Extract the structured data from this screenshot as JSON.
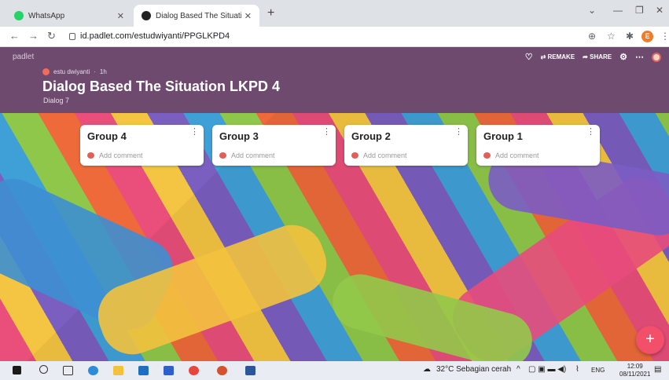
{
  "browser": {
    "tabs": [
      {
        "title": "WhatsApp",
        "active": false
      },
      {
        "title": "Dialog Based The Situation LKPD",
        "active": true
      }
    ],
    "url": "id.padlet.com/estudwiyanti/PPGLKPD4",
    "profile_initial": "E"
  },
  "padlet": {
    "logo": "padlet",
    "actions": {
      "remake": "REMAKE",
      "share": "SHARE"
    },
    "author": "estu dwiyanti",
    "time_ago": "1h",
    "title": "Dialog Based The Situation LKPD 4",
    "subtitle": "Dialog 7",
    "columns": [
      {
        "title": "Group 4",
        "comment_placeholder": "Add comment"
      },
      {
        "title": "Group 3",
        "comment_placeholder": "Add comment"
      },
      {
        "title": "Group 2",
        "comment_placeholder": "Add comment"
      },
      {
        "title": "Group 1",
        "comment_placeholder": "Add comment"
      }
    ],
    "fab_label": "+"
  },
  "taskbar": {
    "weather": "32°C  Sebagian cerah",
    "lang": "ENG",
    "time": "12:09",
    "date": "08/11/2021"
  },
  "colors": {
    "header": "#6d4a6e",
    "fab": "#f24f6b"
  }
}
